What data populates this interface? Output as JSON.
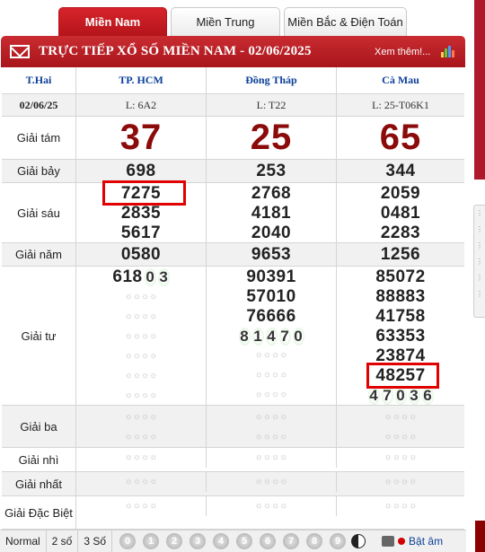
{
  "tabs": [
    {
      "label": "Miền Nam",
      "active": true
    },
    {
      "label": "Miền Trung",
      "active": false
    },
    {
      "label": "Miền Bắc & Điện Toán",
      "active": false
    }
  ],
  "header": {
    "title": "TRỰC TIẾP XỔ SỐ MIỀN NAM - 02/06/2025",
    "more": "Xem thêm!..."
  },
  "table": {
    "day": "T.Hai",
    "date": "02/06/25",
    "provinces": [
      "TP. HCM",
      "Đồng Tháp",
      "Cà Mau"
    ],
    "codes": [
      "L: 6A2",
      "L: T22",
      "L: 25-T06K1"
    ],
    "prizes": {
      "tam": {
        "label": "Giải tám",
        "values": [
          "37",
          "25",
          "65"
        ]
      },
      "bay": {
        "label": "Giải bảy",
        "values": [
          "698",
          "253",
          "344"
        ]
      },
      "sau": {
        "label": "Giải sáu",
        "values": [
          [
            "7275",
            "2835",
            "5617"
          ],
          [
            "2768",
            "4181",
            "2040"
          ],
          [
            "2059",
            "0481",
            "2283"
          ]
        ]
      },
      "nam": {
        "label": "Giải năm",
        "values": [
          "0580",
          "9653",
          "1256"
        ]
      },
      "tu": {
        "label": "Giải tư",
        "hcm": {
          "first_fixed": "618",
          "first_spin": [
            "0",
            "3"
          ]
        },
        "dt": {
          "fixed": [
            "90391",
            "57010",
            "76666"
          ],
          "spin": [
            "8",
            "1",
            "4",
            "7",
            "0"
          ]
        },
        "cm": {
          "fixed": [
            "85072",
            "88883",
            "41758",
            "63353",
            "23874",
            "48257"
          ],
          "spin": [
            "4",
            "7",
            "0",
            "3",
            "6"
          ]
        }
      },
      "ba": {
        "label": "Giải ba"
      },
      "nhi": {
        "label": "Giải nhì"
      },
      "nhat": {
        "label": "Giải nhất"
      },
      "db": {
        "label": "Giải Đặc Biệt"
      }
    },
    "pending": "☼☼☼☼"
  },
  "footer": {
    "normal": "Normal",
    "two": "2 số",
    "three": "3 Số",
    "digits": [
      "0",
      "1",
      "2",
      "3",
      "4",
      "5",
      "6",
      "7",
      "8",
      "9"
    ],
    "sound": "Bật âm"
  },
  "colors": {
    "brand_red": "#b5141b",
    "highlight": "#e00000",
    "prize8": "#8b0a0a",
    "province_blue": "#0b3f99"
  }
}
